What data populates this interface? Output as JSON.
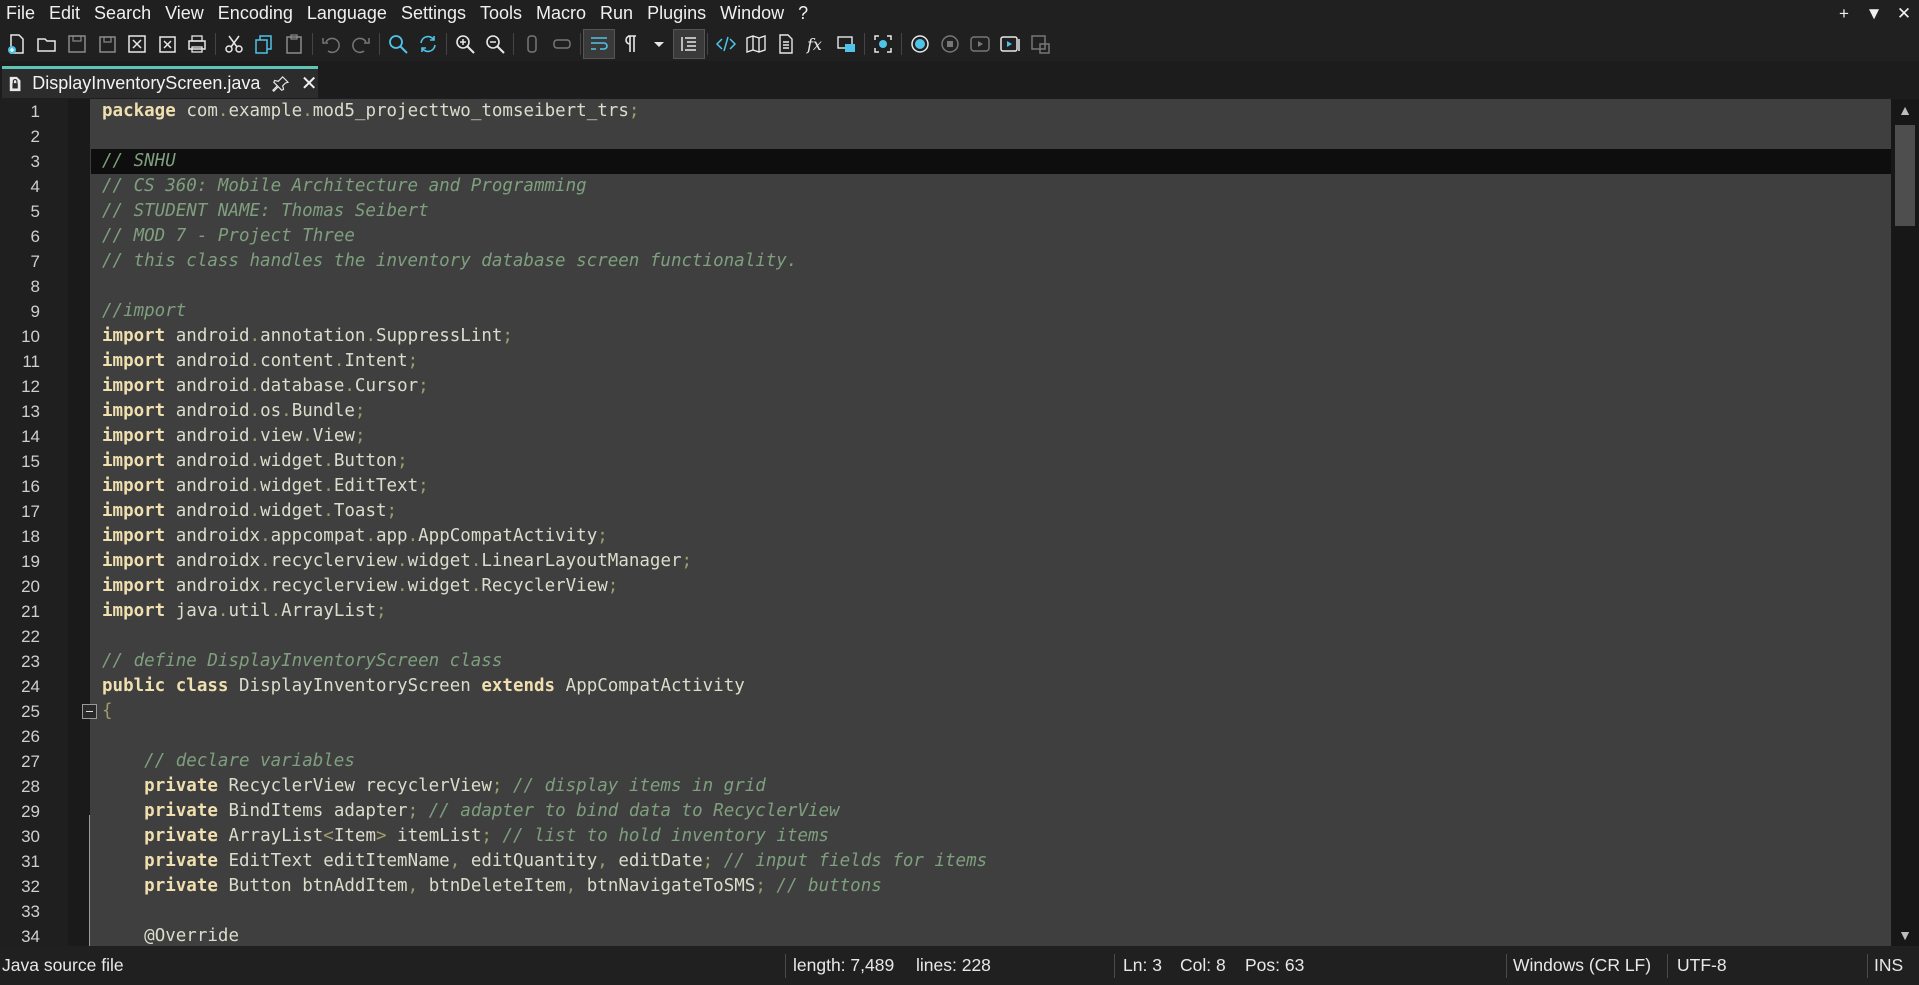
{
  "menu": [
    "File",
    "Edit",
    "Search",
    "View",
    "Encoding",
    "Language",
    "Settings",
    "Tools",
    "Macro",
    "Run",
    "Plugins",
    "Window",
    "?"
  ],
  "window_controls": [
    "+",
    "▼",
    "✕"
  ],
  "tab": {
    "label": "DisplayInventoryScreen.java"
  },
  "editor": {
    "current_line": 3,
    "lines": [
      {
        "n": "1",
        "html": "<span class=\"kw\">package</span> <span class=\"pl\">com</span><span class=\"op\">.</span><span class=\"pl\">example</span><span class=\"op\">.</span><span class=\"pl\">mod5_projecttwo_tomseibert_trs</span><span class=\"op\">;</span>"
      },
      {
        "n": "2",
        "html": ""
      },
      {
        "n": "3",
        "html": "<span class=\"cm\">// SNHU</span>"
      },
      {
        "n": "4",
        "html": "<span class=\"cm\">// CS 360: Mobile Architecture and Programming</span>"
      },
      {
        "n": "5",
        "html": "<span class=\"cm\">// STUDENT NAME: Thomas Seibert</span>"
      },
      {
        "n": "6",
        "html": "<span class=\"cm\">// MOD 7 - Project Three</span>"
      },
      {
        "n": "7",
        "html": "<span class=\"cm\">// this class handles the inventory database screen functionality.</span>"
      },
      {
        "n": "8",
        "html": ""
      },
      {
        "n": "9",
        "html": "<span class=\"cm\">//import</span>"
      },
      {
        "n": "10",
        "html": "<span class=\"kw\">import</span> <span class=\"pl\">android</span><span class=\"op\">.</span><span class=\"pl\">annotation</span><span class=\"op\">.</span><span class=\"pl\">SuppressLint</span><span class=\"op\">;</span>"
      },
      {
        "n": "11",
        "html": "<span class=\"kw\">import</span> <span class=\"pl\">android</span><span class=\"op\">.</span><span class=\"pl\">content</span><span class=\"op\">.</span><span class=\"pl\">Intent</span><span class=\"op\">;</span>"
      },
      {
        "n": "12",
        "html": "<span class=\"kw\">import</span> <span class=\"pl\">android</span><span class=\"op\">.</span><span class=\"pl\">database</span><span class=\"op\">.</span><span class=\"pl\">Cursor</span><span class=\"op\">;</span>"
      },
      {
        "n": "13",
        "html": "<span class=\"kw\">import</span> <span class=\"pl\">android</span><span class=\"op\">.</span><span class=\"pl\">os</span><span class=\"op\">.</span><span class=\"pl\">Bundle</span><span class=\"op\">;</span>"
      },
      {
        "n": "14",
        "html": "<span class=\"kw\">import</span> <span class=\"pl\">android</span><span class=\"op\">.</span><span class=\"pl\">view</span><span class=\"op\">.</span><span class=\"pl\">View</span><span class=\"op\">;</span>"
      },
      {
        "n": "15",
        "html": "<span class=\"kw\">import</span> <span class=\"pl\">android</span><span class=\"op\">.</span><span class=\"pl\">widget</span><span class=\"op\">.</span><span class=\"pl\">Button</span><span class=\"op\">;</span>"
      },
      {
        "n": "16",
        "html": "<span class=\"kw\">import</span> <span class=\"pl\">android</span><span class=\"op\">.</span><span class=\"pl\">widget</span><span class=\"op\">.</span><span class=\"pl\">EditText</span><span class=\"op\">;</span>"
      },
      {
        "n": "17",
        "html": "<span class=\"kw\">import</span> <span class=\"pl\">android</span><span class=\"op\">.</span><span class=\"pl\">widget</span><span class=\"op\">.</span><span class=\"pl\">Toast</span><span class=\"op\">;</span>"
      },
      {
        "n": "18",
        "html": "<span class=\"kw\">import</span> <span class=\"pl\">androidx</span><span class=\"op\">.</span><span class=\"pl\">appcompat</span><span class=\"op\">.</span><span class=\"pl\">app</span><span class=\"op\">.</span><span class=\"pl\">AppCompatActivity</span><span class=\"op\">;</span>"
      },
      {
        "n": "19",
        "html": "<span class=\"kw\">import</span> <span class=\"pl\">androidx</span><span class=\"op\">.</span><span class=\"pl\">recyclerview</span><span class=\"op\">.</span><span class=\"pl\">widget</span><span class=\"op\">.</span><span class=\"pl\">LinearLayoutManager</span><span class=\"op\">;</span>"
      },
      {
        "n": "20",
        "html": "<span class=\"kw\">import</span> <span class=\"pl\">androidx</span><span class=\"op\">.</span><span class=\"pl\">recyclerview</span><span class=\"op\">.</span><span class=\"pl\">widget</span><span class=\"op\">.</span><span class=\"pl\">RecyclerView</span><span class=\"op\">;</span>"
      },
      {
        "n": "21",
        "html": "<span class=\"kw\">import</span> <span class=\"pl\">java</span><span class=\"op\">.</span><span class=\"pl\">util</span><span class=\"op\">.</span><span class=\"pl\">ArrayList</span><span class=\"op\">;</span>"
      },
      {
        "n": "22",
        "html": ""
      },
      {
        "n": "23",
        "html": "<span class=\"cm\">// define DisplayInventoryScreen class</span>"
      },
      {
        "n": "24",
        "html": "<span class=\"kw\">public</span> <span class=\"kw\">class</span> <span class=\"pl\">DisplayInventoryScreen</span> <span class=\"kw\">extends</span> <span class=\"pl\">AppCompatActivity</span>"
      },
      {
        "n": "25",
        "html": "<span class=\"op\">{</span>"
      },
      {
        "n": "26",
        "html": ""
      },
      {
        "n": "27",
        "html": "    <span class=\"cm\">// declare variables</span>"
      },
      {
        "n": "28",
        "html": "    <span class=\"kw\">private</span> <span class=\"pl\">RecyclerView recyclerView</span><span class=\"op\">;</span> <span class=\"cm\">// display items in grid</span>"
      },
      {
        "n": "29",
        "html": "    <span class=\"kw\">private</span> <span class=\"pl\">BindItems adapter</span><span class=\"op\">;</span> <span class=\"cm\">// adapter to bind data to RecyclerView</span>"
      },
      {
        "n": "30",
        "html": "    <span class=\"kw\">private</span> <span class=\"pl\">ArrayList</span><span class=\"op\">&lt;</span><span class=\"pl\">Item</span><span class=\"op\">&gt;</span> <span class=\"pl\">itemList</span><span class=\"op\">;</span> <span class=\"cm\">// list to hold inventory items</span>"
      },
      {
        "n": "31",
        "html": "    <span class=\"kw\">private</span> <span class=\"pl\">EditText editItemName</span><span class=\"op\">,</span> <span class=\"pl\">editQuantity</span><span class=\"op\">,</span> <span class=\"pl\">editDate</span><span class=\"op\">;</span> <span class=\"cm\">// input fields for items</span>"
      },
      {
        "n": "32",
        "html": "    <span class=\"kw\">private</span> <span class=\"pl\">Button btnAddItem</span><span class=\"op\">,</span> <span class=\"pl\">btnDeleteItem</span><span class=\"op\">,</span> <span class=\"pl\">btnNavigateToSMS</span><span class=\"op\">;</span> <span class=\"cm\">// buttons</span>"
      },
      {
        "n": "33",
        "html": ""
      },
      {
        "n": "34",
        "html": "    <span class=\"an\">@Override</span>"
      }
    ]
  },
  "status": {
    "file_type": "Java source file",
    "length": "length: 7,489",
    "lines": "lines: 228",
    "ln": "Ln: 3",
    "col": "Col: 8",
    "pos": "Pos: 63",
    "eol": "Windows (CR LF)",
    "encoding": "UTF-8",
    "mode": "INS"
  },
  "toolbar_icons": [
    "new-file-icon",
    "open-file-icon",
    "save-icon",
    "save-all-icon",
    "close-icon",
    "close-all-icon",
    "print-icon",
    "cut-icon",
    "copy-icon",
    "paste-icon",
    "undo-icon",
    "redo-icon",
    "find-icon",
    "replace-icon",
    "zoom-in-icon",
    "zoom-out-icon",
    "sync-vertical-icon",
    "sync-horizontal-icon",
    "word-wrap-icon",
    "show-all-chars-icon",
    "dropdown-icon",
    "indent-guide-icon",
    "xml-tag-icon",
    "document-map-icon",
    "document-list-icon",
    "function-list-icon",
    "folder-workspace-icon",
    "monitoring-icon",
    "record-macro-icon",
    "stop-macro-icon",
    "play-macro-icon",
    "run-macro-multiple-icon",
    "save-macro-icon"
  ],
  "colors": {
    "accent": "#5ec4b6",
    "keyword": "#f0dfaf",
    "comment": "#7f9f7f",
    "editor_bg": "#3f3f3f",
    "current_line_bg": "#0e0e0e"
  }
}
